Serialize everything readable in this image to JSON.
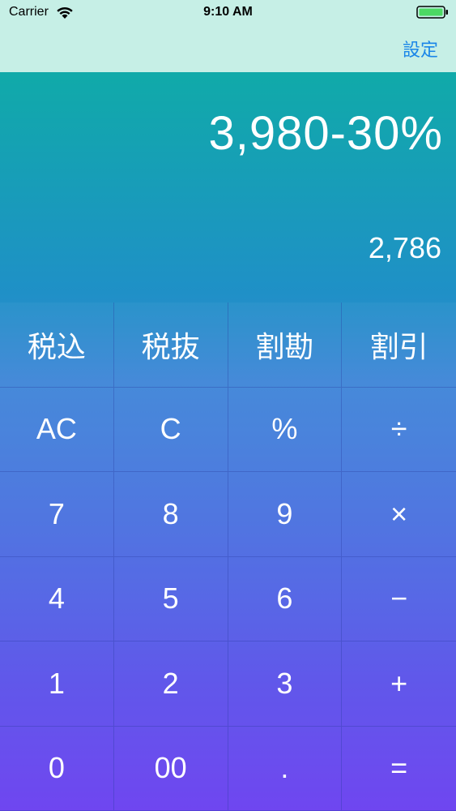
{
  "status_bar": {
    "carrier": "Carrier",
    "time": "9:10 AM"
  },
  "nav": {
    "settings_label": "設定",
    "settings_color": "#1a86e8",
    "background_color": "#c6efe6"
  },
  "display": {
    "expression": "3,980-30%",
    "result": "2,786"
  },
  "keypad": {
    "rows": [
      [
        "税込",
        "税抜",
        "割勘",
        "割引"
      ],
      [
        "AC",
        "C",
        "%",
        "÷"
      ],
      [
        "7",
        "8",
        "9",
        "×"
      ],
      [
        "4",
        "5",
        "6",
        "−"
      ],
      [
        "1",
        "2",
        "3",
        "+"
      ],
      [
        "0",
        "00",
        ".",
        "="
      ]
    ]
  },
  "colors": {
    "gradient_top": "#10aaa9",
    "gradient_bottom": "#6a3ff0"
  }
}
